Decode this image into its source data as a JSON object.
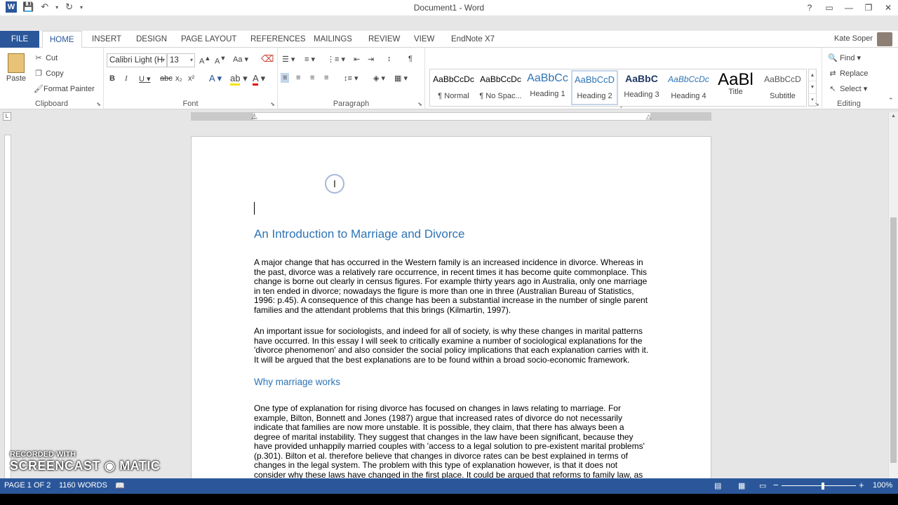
{
  "window": {
    "title": "Document1 - Word",
    "logo": "W",
    "controls": [
      "?",
      "▭",
      "—",
      "❐",
      "✕"
    ]
  },
  "tabs": [
    "FILE",
    "HOME",
    "INSERT",
    "DESIGN",
    "PAGE LAYOUT",
    "REFERENCES",
    "MAILINGS",
    "REVIEW",
    "VIEW",
    "EndNote X7"
  ],
  "user": "Kate Soper",
  "ribbon": {
    "clipboard": {
      "label": "Clipboard",
      "paste": "Paste",
      "cut": "Cut",
      "copy": "Copy",
      "format_painter": "Format Painter"
    },
    "font": {
      "label": "Font",
      "name": "Calibri Light (H",
      "size": "13"
    },
    "paragraph": {
      "label": "Paragraph"
    },
    "styles": {
      "label": "Styles",
      "items": [
        {
          "sample": "AaBbCcDc",
          "name": "¶ Normal"
        },
        {
          "sample": "AaBbCcDc",
          "name": "¶ No Spac..."
        },
        {
          "sample": "AaBbCc",
          "name": "Heading 1"
        },
        {
          "sample": "AaBbCcD",
          "name": "Heading 2"
        },
        {
          "sample": "AaBbC",
          "name": "Heading 3"
        },
        {
          "sample": "AaBbCcDc",
          "name": "Heading 4"
        },
        {
          "sample": "AaBl",
          "name": "Title"
        },
        {
          "sample": "AaBbCcD",
          "name": "Subtitle"
        }
      ]
    },
    "editing": {
      "label": "Editing",
      "find": "Find",
      "replace": "Replace",
      "select": "Select"
    }
  },
  "document": {
    "heading1": "An Introduction to Marriage and Divorce",
    "para1": "A major change that has occurred in the Western family is an increased incidence in divorce. Whereas in the past, divorce was a relatively rare occurrence, in recent times it has become quite commonplace. This change is borne out clearly in census figures. For example thirty years ago in Australia, only one marriage in ten ended in divorce; nowadays the figure is more than one in three (Australian Bureau of Statistics, 1996: p.45). A consequence of this change has been a substantial increase in the number of single parent families and the attendant problems that this brings (Kilmartin, 1997).",
    "para2": "An important issue for sociologists, and indeed for all of society, is why these changes in marital patterns have occurred. In this essay I will seek to critically examine a number of sociological explanations for the 'divorce phenomenon' and also consider the social policy implications that each explanation carries with it. It will be argued that the best explanations are to be found within a broad socio-economic framework.",
    "heading2": "Why marriage works",
    "para3": "One type of explanation for rising divorce has focused on changes in laws relating to marriage. For example, Bilton, Bonnett and Jones (1987) argue that increased rates of divorce do not necessarily indicate that families are now more unstable. It is possible, they claim, that there has always been a degree of marital instability. They suggest that changes in the law have been significant, because they have provided unhappily married couples with 'access to a legal solution to pre-existent marital problems' (p.301). Bilton et al. therefore believe that changes in divorce rates can be best explained in terms of changes in the legal system. The problem with this type of explanation however, is that it does not consider why these laws have changed in the first place. It could be argued that reforms to family law, as well as the increased rate"
  },
  "watermark": {
    "line1": "RECORDED WITH",
    "line2": "SCREENCAST",
    "line3": "MATIC"
  },
  "status": {
    "page": "PAGE 1 OF 2",
    "words": "1160 WORDS",
    "zoom": "100%",
    "zoom_minus": "−",
    "zoom_plus": "+"
  },
  "colors": {
    "accent": "#2b579a",
    "heading": "#2e74b5"
  }
}
